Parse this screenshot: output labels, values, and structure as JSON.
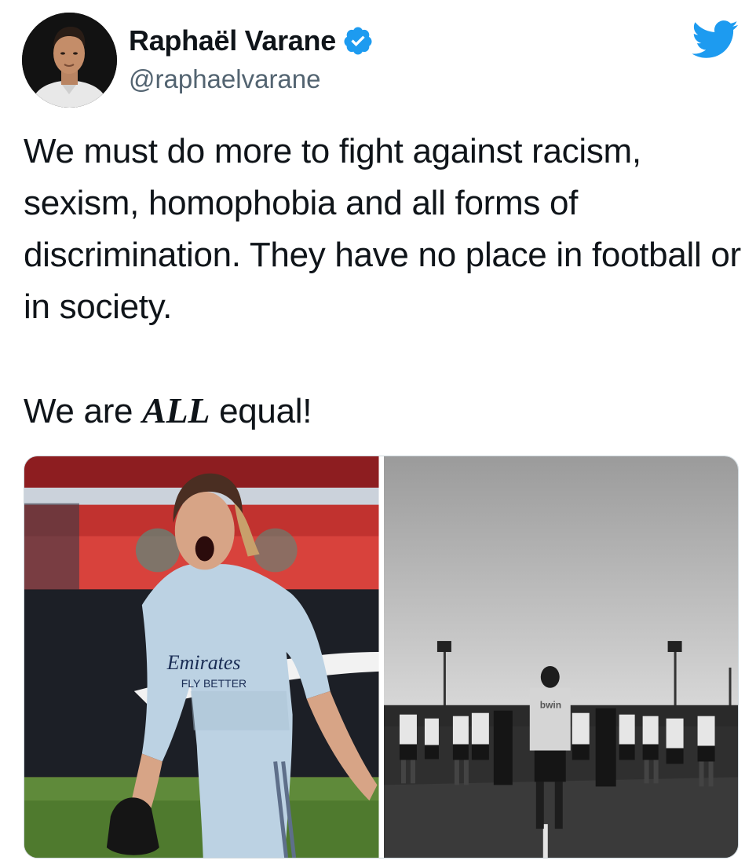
{
  "author": {
    "display_name": "Raphaël Varane",
    "handle": "@raphaelvarane",
    "verified": true,
    "avatar_icon": "profile-photo"
  },
  "brand": {
    "logo_icon": "twitter-bird-icon",
    "color": "#1d9bf0"
  },
  "tweet": {
    "line1": "We must do more to fight against racism, sexism, homophobia and all forms of discrimination. They have no place in football or in society.",
    "line2_prefix": "We are ",
    "line2_emphasis": "ALL",
    "line2_suffix": " equal!"
  },
  "media": {
    "images": [
      {
        "name": "goalkeeper-celebrating-photo",
        "jersey_text": "Emirates",
        "jersey_sub": "FLY BETTER"
      },
      {
        "name": "team-standing-on-pitch-photo",
        "jersey_text": "bwin"
      }
    ]
  }
}
